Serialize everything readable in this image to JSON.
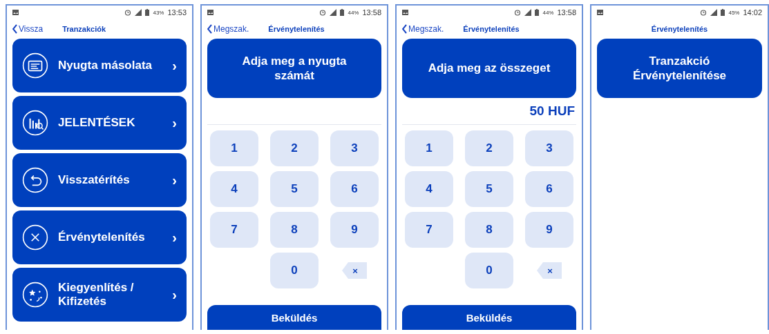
{
  "screens": [
    {
      "kind": "menu",
      "status": {
        "battery": "43%",
        "time": "13:53"
      },
      "back": "Vissza",
      "title": "Tranzakciók",
      "items": [
        {
          "label": "Nyugta másolata",
          "chevron": "›"
        },
        {
          "label": "JELENTÉSEK",
          "chevron": "›"
        },
        {
          "label": "Visszatérítés",
          "chevron": "›"
        },
        {
          "label": "Érvénytelenítés",
          "chevron": "›"
        },
        {
          "label": "Kiegyenlítés / Kifizetés",
          "chevron": "›"
        }
      ]
    },
    {
      "kind": "keypad",
      "status": {
        "battery": "44%",
        "time": "13:58"
      },
      "back": "Megszak.",
      "title": "Érvénytelenítés",
      "prompt": "Adja meg a nyugta számát",
      "keys": [
        {
          "kind": "digit",
          "label": "1"
        },
        {
          "kind": "digit",
          "label": "2"
        },
        {
          "kind": "digit",
          "label": "3"
        },
        {
          "kind": "digit",
          "label": "4"
        },
        {
          "kind": "digit",
          "label": "5"
        },
        {
          "kind": "digit",
          "label": "6"
        },
        {
          "kind": "digit",
          "label": "7"
        },
        {
          "kind": "digit",
          "label": "8"
        },
        {
          "kind": "digit",
          "label": "9"
        },
        {
          "kind": "blank"
        },
        {
          "kind": "digit",
          "label": "0"
        },
        {
          "kind": "backspace",
          "label": "×"
        }
      ],
      "submit": "Beküldés"
    },
    {
      "kind": "keypad",
      "status": {
        "battery": "44%",
        "time": "13:58"
      },
      "back": "Megszak.",
      "title": "Érvénytelenítés",
      "prompt": "Adja meg az összeget",
      "amount": "50 HUF",
      "keys": [
        {
          "kind": "digit",
          "label": "1"
        },
        {
          "kind": "digit",
          "label": "2"
        },
        {
          "kind": "digit",
          "label": "3"
        },
        {
          "kind": "digit",
          "label": "4"
        },
        {
          "kind": "digit",
          "label": "5"
        },
        {
          "kind": "digit",
          "label": "6"
        },
        {
          "kind": "digit",
          "label": "7"
        },
        {
          "kind": "digit",
          "label": "8"
        },
        {
          "kind": "digit",
          "label": "9"
        },
        {
          "kind": "blank"
        },
        {
          "kind": "digit",
          "label": "0"
        },
        {
          "kind": "backspace",
          "label": "×"
        }
      ],
      "submit": "Beküldés"
    },
    {
      "kind": "message",
      "status": {
        "battery": "45%",
        "time": "14:02"
      },
      "title": "Érvénytelenítés",
      "prompt": "Tranzakció Érvénytelenítése"
    }
  ]
}
